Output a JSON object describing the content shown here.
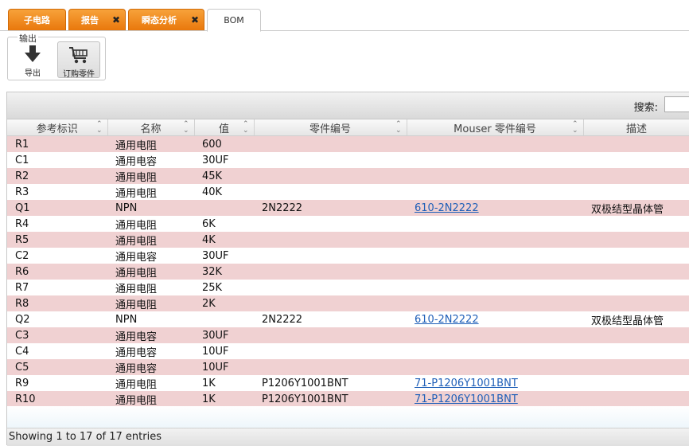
{
  "tabs": [
    {
      "label": "子电路",
      "closable": false
    },
    {
      "label": "报告",
      "closable": true
    },
    {
      "label": "瞬态分析",
      "closable": true
    },
    {
      "label": "BOM",
      "closable": false
    }
  ],
  "toolbar": {
    "group_label": "输出",
    "export_label": "导出",
    "order_label": "订购零件"
  },
  "search": {
    "label": "搜索:",
    "value": ""
  },
  "columns": [
    "参考标识",
    "名称",
    "值",
    "零件编号",
    "Mouser 零件编号",
    "描述"
  ],
  "rows": [
    [
      "R1",
      "通用电阻",
      "600",
      "",
      "",
      ""
    ],
    [
      "C1",
      "通用电容",
      "30UF",
      "",
      "",
      ""
    ],
    [
      "R2",
      "通用电阻",
      "45K",
      "",
      "",
      ""
    ],
    [
      "R3",
      "通用电阻",
      "40K",
      "",
      "",
      ""
    ],
    [
      "Q1",
      "NPN",
      "",
      "2N2222",
      "610-2N2222",
      "双极结型晶体管"
    ],
    [
      "R4",
      "通用电阻",
      "6K",
      "",
      "",
      ""
    ],
    [
      "R5",
      "通用电阻",
      "4K",
      "",
      "",
      ""
    ],
    [
      "C2",
      "通用电容",
      "30UF",
      "",
      "",
      ""
    ],
    [
      "R6",
      "通用电阻",
      "32K",
      "",
      "",
      ""
    ],
    [
      "R7",
      "通用电阻",
      "25K",
      "",
      "",
      ""
    ],
    [
      "R8",
      "通用电阻",
      "2K",
      "",
      "",
      ""
    ],
    [
      "Q2",
      "NPN",
      "",
      "2N2222",
      "610-2N2222",
      "双极结型晶体管"
    ],
    [
      "C3",
      "通用电容",
      "30UF",
      "",
      "",
      ""
    ],
    [
      "C4",
      "通用电容",
      "10UF",
      "",
      "",
      ""
    ],
    [
      "C5",
      "通用电容",
      "10UF",
      "",
      "",
      ""
    ],
    [
      "R9",
      "通用电阻",
      "1K",
      "P1206Y1001BNT",
      "71-P1206Y1001BNT",
      ""
    ],
    [
      "R10",
      "通用电阻",
      "1K",
      "P1206Y1001BNT",
      "71-P1206Y1001BNT",
      ""
    ]
  ],
  "footer": {
    "info": "Showing 1 to 17 of 17 entries"
  },
  "colors": {
    "tab_orange": "#e9780c",
    "row_alt": "#f0d1d2",
    "link": "#1f5fb8"
  }
}
